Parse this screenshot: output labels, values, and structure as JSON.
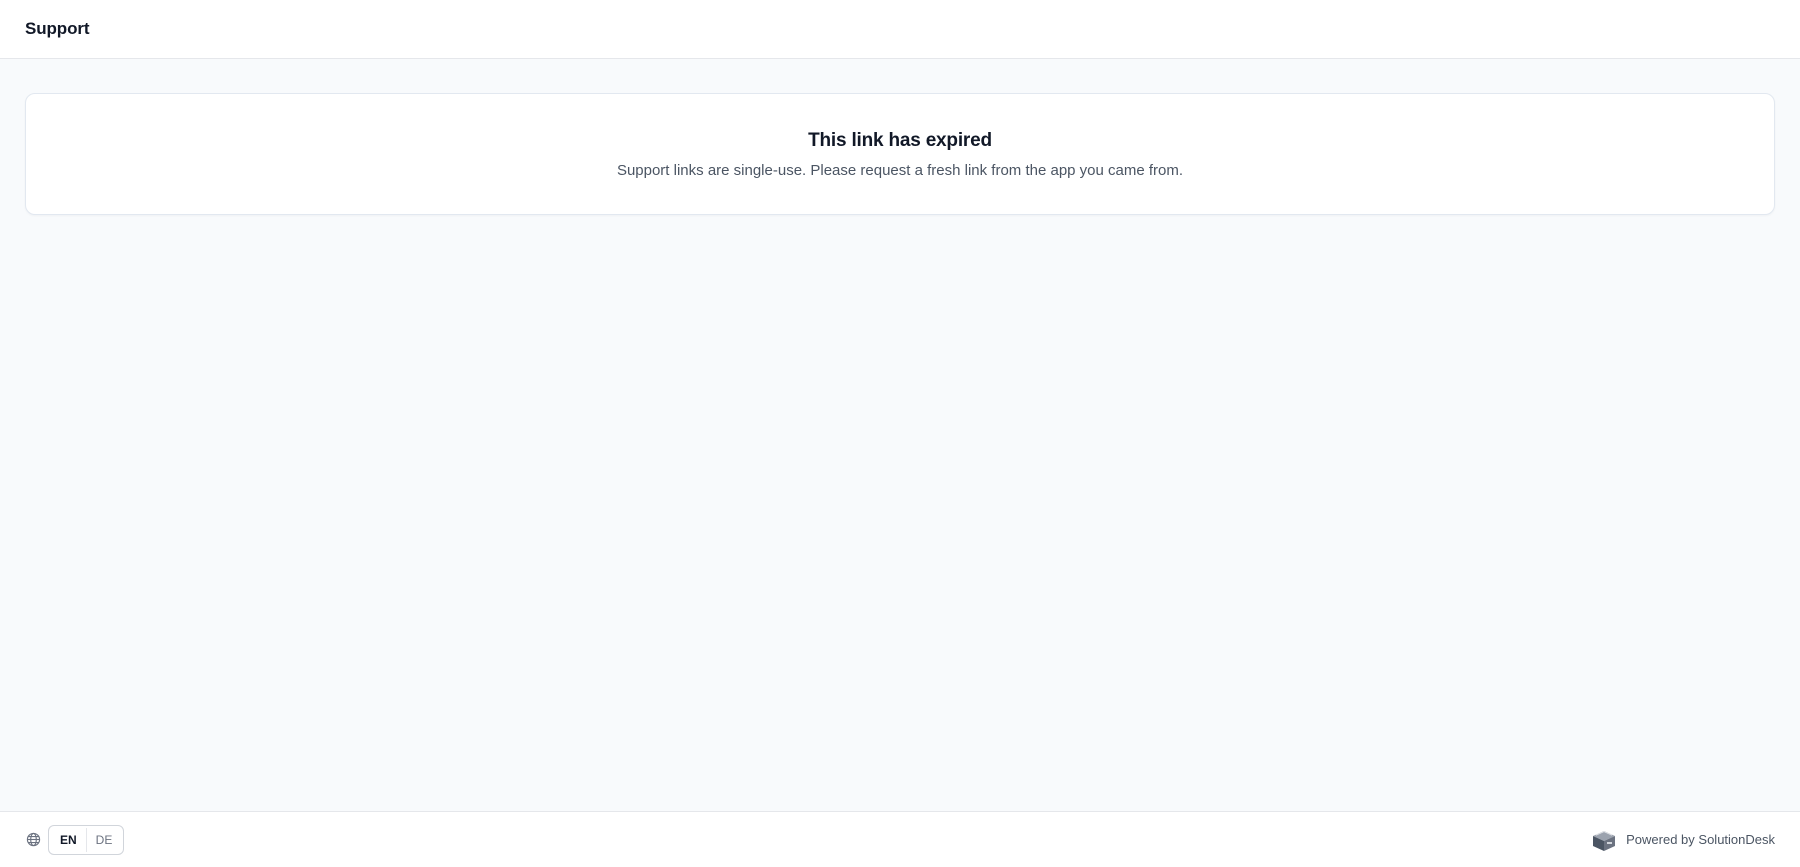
{
  "header": {
    "title": "Support"
  },
  "notice": {
    "title": "This link has expired",
    "message": "Support links are single-use. Please request a fresh link from the app you came from."
  },
  "footer": {
    "globe_icon": "globe-icon",
    "languages": [
      {
        "code": "EN",
        "selected": true
      },
      {
        "code": "DE",
        "selected": false
      }
    ],
    "powered_by": "Powered by SolutionDesk",
    "logo_icon": "solutiondesk-logo-icon"
  }
}
